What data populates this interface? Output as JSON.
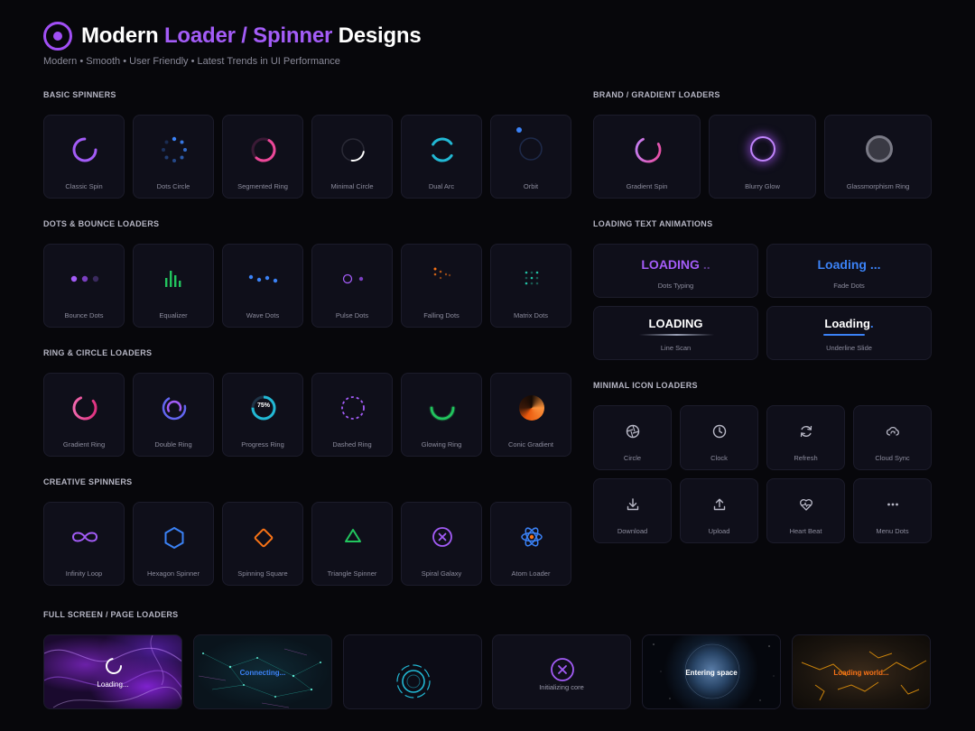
{
  "header": {
    "title_prefix": "Modern ",
    "title_accent": "Loader / Spinner",
    "title_suffix": " Designs",
    "subtitle": "Modern • Smooth • User Friendly • Latest Trends in UI Performance"
  },
  "sections": {
    "basic": "BASIC SPINNERS",
    "dots": "DOTS & BOUNCE LOADERS",
    "ring": "RING & CIRCLE LOADERS",
    "creative": "CREATIVE SPINNERS",
    "brand": "BRAND / GRADIENT LOADERS",
    "text": "LOADING TEXT ANIMATIONS",
    "icons": "MINIMAL ICON LOADERS",
    "fullscreen": "FULL SCREEN / PAGE LOADERS"
  },
  "basic": [
    "Classic Spin",
    "Dots Circle",
    "Segmented Ring",
    "Minimal Circle",
    "Dual Arc",
    "Orbit"
  ],
  "dots": [
    "Bounce Dots",
    "Equalizer",
    "Wave Dots",
    "Pulse Dots",
    "Falling Dots",
    "Matrix Dots"
  ],
  "ring": [
    "Gradient Ring",
    "Double Ring",
    "Progress Ring",
    "Dashed Ring",
    "Glowing Ring",
    "Conic Gradient"
  ],
  "progress_value": "75%",
  "creative": [
    "Infinity Loop",
    "Hexagon Spinner",
    "Spinning Square",
    "Triangle Spinner",
    "Spiral Galaxy",
    "Atom Loader"
  ],
  "brand": [
    "Gradient Spin",
    "Blurry Glow",
    "Glassmorphism Ring"
  ],
  "text_anims": [
    {
      "text": "LOADING",
      "suffix": " ..",
      "label": "Dots Typing"
    },
    {
      "text": "Loading",
      "suffix": " ...",
      "label": "Fade Dots"
    },
    {
      "text": "LOADING",
      "suffix": "",
      "label": "Line Scan"
    },
    {
      "text": "Loading",
      "suffix": ".",
      "label": "Underline Slide"
    }
  ],
  "icons": [
    "Circle",
    "Clock",
    "Refresh",
    "Cloud Sync",
    "Download",
    "Upload",
    "Heart Beat",
    "Menu Dots"
  ],
  "fullscreen": [
    "Loading...",
    "Connecting...",
    "",
    "Initializing core",
    "Entering space",
    "Loading world..."
  ],
  "colors": {
    "accent": "#a35cf7",
    "blue": "#3b82f6",
    "pink": "#ec4899",
    "cyan": "#22b8d4",
    "green": "#22c55e",
    "orange": "#f97316",
    "card": "#0f0f1a"
  }
}
